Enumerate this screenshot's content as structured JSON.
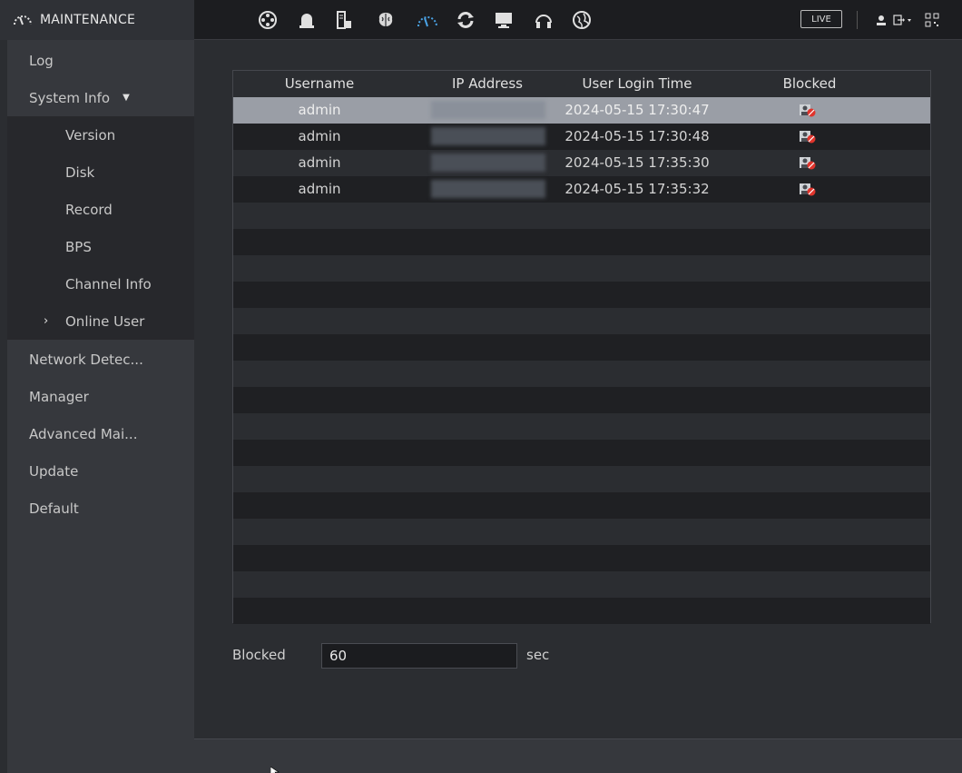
{
  "app": {
    "title": "MAINTENANCE",
    "icon": "gauge-icon"
  },
  "toolbar": {
    "icons": [
      "film-reel-icon",
      "alarm-light-icon",
      "storage-device-icon",
      "brain-icon",
      "gauge-icon",
      "refresh-icon",
      "monitor-icon",
      "headset-icon",
      "globe-icon"
    ],
    "live_label": "LIVE",
    "right_icons": [
      "user-icon",
      "logout-icon",
      "qr-icon"
    ]
  },
  "sidebar": {
    "items": [
      {
        "label": "Log"
      },
      {
        "label": "System Info"
      },
      {
        "label": "Version"
      },
      {
        "label": "Disk"
      },
      {
        "label": "Record"
      },
      {
        "label": "BPS"
      },
      {
        "label": "Channel Info"
      },
      {
        "label": "Online User"
      },
      {
        "label": "Network Detec..."
      },
      {
        "label": "Manager"
      },
      {
        "label": "Advanced Mai..."
      },
      {
        "label": "Update"
      },
      {
        "label": "Default"
      }
    ]
  },
  "table": {
    "headers": [
      "Username",
      "IP Address",
      "User Login Time",
      "Blocked"
    ],
    "rows": [
      {
        "username": "admin",
        "login_time": "2024-05-15 17:30:47"
      },
      {
        "username": "admin",
        "login_time": "2024-05-15 17:30:48"
      },
      {
        "username": "admin",
        "login_time": "2024-05-15 17:35:30"
      },
      {
        "username": "admin",
        "login_time": "2024-05-15 17:35:32"
      }
    ]
  },
  "blocked": {
    "label": "Blocked",
    "value": "60",
    "unit": "sec"
  },
  "colors": {
    "accent": "#4aa3e6",
    "background": "#2b2d31",
    "selected_row": "#9a9ea6",
    "block_badge": "#e0342c"
  }
}
